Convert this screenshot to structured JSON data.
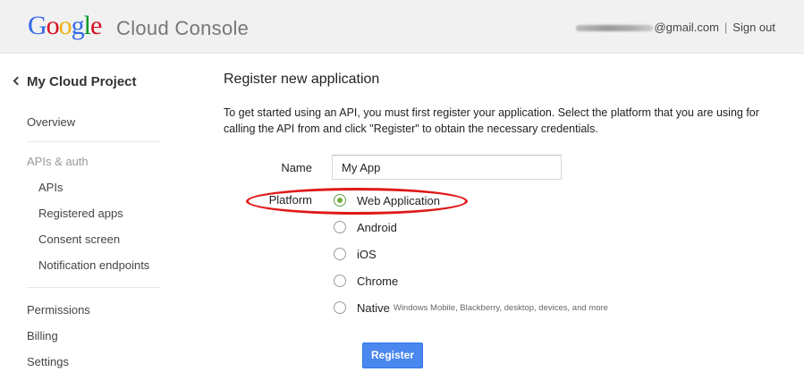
{
  "header": {
    "logo_letters": [
      {
        "char": "G",
        "color": "#3369e8"
      },
      {
        "char": "o",
        "color": "#d50f25"
      },
      {
        "char": "o",
        "color": "#eeb211"
      },
      {
        "char": "g",
        "color": "#3369e8"
      },
      {
        "char": "l",
        "color": "#009925"
      },
      {
        "char": "e",
        "color": "#d50f25"
      }
    ],
    "product": "Cloud Console",
    "email_suffix": "@gmail.com",
    "separator": "|",
    "sign_out": "Sign out"
  },
  "sidebar": {
    "back_label": "My Cloud Project",
    "overview": "Overview",
    "apis_auth": "APIs & auth",
    "apis": "APIs",
    "registered_apps": "Registered apps",
    "consent_screen": "Consent screen",
    "notification_endpoints": "Notification endpoints",
    "permissions": "Permissions",
    "billing": "Billing",
    "settings": "Settings"
  },
  "main": {
    "heading": "Register new application",
    "intro": "To get started using an API, you must first register your application. Select the platform that you are using for calling the API from and click \"Register\" to obtain the necessary credentials.",
    "name_label": "Name",
    "name_value": "My App",
    "platform_label": "Platform",
    "platforms": [
      {
        "label": "Web Application",
        "checked": true
      },
      {
        "label": "Android",
        "checked": false
      },
      {
        "label": "iOS",
        "checked": false
      },
      {
        "label": "Chrome",
        "checked": false
      },
      {
        "label": "Native",
        "hint": "Windows Mobile, Blackberry, desktop, devices, and more",
        "checked": false
      }
    ],
    "register_button": "Register"
  },
  "colors": {
    "accent_button": "#4a87ee",
    "highlight_annotation": "#e01818",
    "radio_selected": "#6fae3c"
  }
}
